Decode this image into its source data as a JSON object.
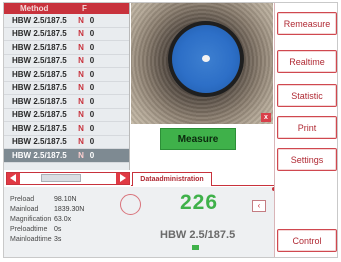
{
  "method_table": {
    "header_method": "Method",
    "header_col2": "F",
    "rows": [
      {
        "method": "HBW 2.5/187.5",
        "sep": "N",
        "val": "0"
      },
      {
        "method": "HBW 2.5/187.5",
        "sep": "N",
        "val": "0"
      },
      {
        "method": "HBW 2.5/187.5",
        "sep": "N",
        "val": "0"
      },
      {
        "method": "HBW 2.5/187.5",
        "sep": "N",
        "val": "0"
      },
      {
        "method": "HBW 2.5/187.5",
        "sep": "N",
        "val": "0"
      },
      {
        "method": "HBW 2.5/187.5",
        "sep": "N",
        "val": "0"
      },
      {
        "method": "HBW 2.5/187.5",
        "sep": "N",
        "val": "0"
      },
      {
        "method": "HBW 2.5/187.5",
        "sep": "N",
        "val": "0"
      },
      {
        "method": "HBW 2.5/187.5",
        "sep": "N",
        "val": "0"
      },
      {
        "method": "HBW 2.5/187.5",
        "sep": "N",
        "val": "0"
      },
      {
        "method": "HBW 2.5/187.5",
        "sep": "N",
        "val": "0"
      }
    ],
    "selected_index": 10
  },
  "camera": {
    "close_label": "x"
  },
  "measure_button": "Measure",
  "tabs": {
    "data_admin": "Dataadministration"
  },
  "params": [
    {
      "label": "Preload",
      "value": "98.10N"
    },
    {
      "label": "Mainload",
      "value": "1839.30N"
    },
    {
      "label": "Magnification",
      "value": "63.0x"
    },
    {
      "label": "Preloadtime",
      "value": "0s"
    },
    {
      "label": "Mainloadtime",
      "value": "3s"
    }
  ],
  "result": {
    "value": "226",
    "method": "HBW 2.5/187.5",
    "side_button": "‹"
  },
  "commands": {
    "remeasure": "Remeasure",
    "realtime": "Realtime",
    "statistic": "Statistic",
    "print": "Print",
    "settings": "Settings",
    "control": "Control"
  },
  "colors": {
    "accent_red": "#c8323c",
    "measure_green": "#3fb14a",
    "indent_blue": "#2d6fc7"
  }
}
